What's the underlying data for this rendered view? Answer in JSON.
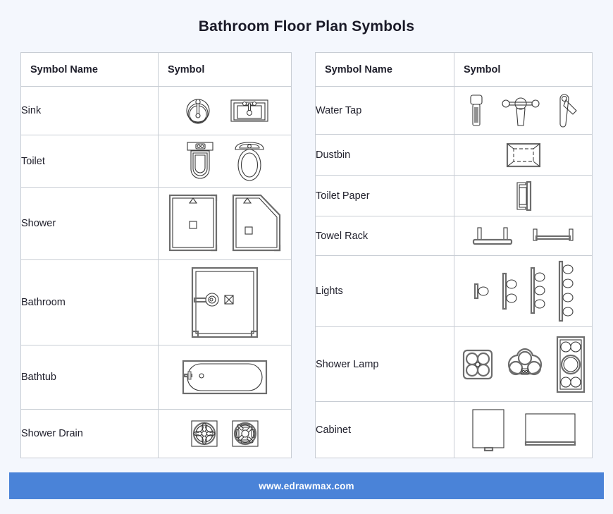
{
  "page": {
    "title": "Bathroom Floor Plan Symbols",
    "background_color": "#f4f7fd",
    "accent_color": "#4a83d8"
  },
  "tables": [
    {
      "id": "left-table",
      "headers": {
        "name": "Symbol Name",
        "symbol": "Symbol"
      },
      "rows": [
        {
          "name": "Sink",
          "symbols": [
            "round-sink-icon",
            "rectangular-sink-icon"
          ]
        },
        {
          "name": "Toilet",
          "symbols": [
            "square-toilet-icon",
            "oval-toilet-icon"
          ]
        },
        {
          "name": "Shower",
          "symbols": [
            "square-shower-icon",
            "corner-shower-icon"
          ]
        },
        {
          "name": "Bathroom",
          "symbols": [
            "bathroom-enclosure-icon"
          ]
        },
        {
          "name": "Bathtub",
          "symbols": [
            "bathtub-icon"
          ]
        },
        {
          "name": "Shower Drain",
          "symbols": [
            "petal-drain-icon",
            "slotted-drain-icon"
          ]
        }
      ]
    },
    {
      "id": "right-table",
      "headers": {
        "name": "Symbol Name",
        "symbol": "Symbol"
      },
      "rows": [
        {
          "name": "Water Tap",
          "symbols": [
            "single-tap-icon",
            "cross-handle-tap-icon",
            "lever-tap-icon"
          ]
        },
        {
          "name": "Dustbin",
          "symbols": [
            "dustbin-icon"
          ]
        },
        {
          "name": "Toilet Paper",
          "symbols": [
            "toilet-paper-holder-icon"
          ]
        },
        {
          "name": "Towel Rack",
          "symbols": [
            "double-post-towel-rack-icon",
            "flat-towel-rack-icon"
          ]
        },
        {
          "name": "Lights",
          "symbols": [
            "light-1-bulb-icon",
            "light-2-bulb-icon",
            "light-3-bulb-icon",
            "light-4-bulb-icon"
          ]
        },
        {
          "name": "Shower Lamp",
          "symbols": [
            "square-quad-lamp-icon",
            "trefoil-lamp-icon",
            "rectangular-lamp-icon"
          ]
        },
        {
          "name": "Cabinet",
          "symbols": [
            "tall-cabinet-icon",
            "wide-cabinet-icon"
          ]
        }
      ]
    }
  ],
  "footer": {
    "site": "www.edrawmax.com"
  }
}
